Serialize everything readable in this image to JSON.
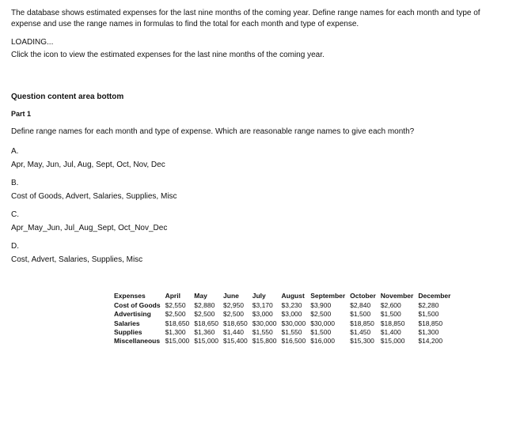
{
  "intro": "The database shows estimated expenses for the last nine months of the coming year. Define range names for each month and type of expense and use the range names in formulas to find the total for each month and type of expense.",
  "loading": "LOADING...",
  "loading_sub": "Click the icon to view the estimated expenses for the last nine months of the coming year.",
  "section_title": "Question content area bottom",
  "part_label": "Part 1",
  "prompt": "Define range names for each month and type of expense. Which are reasonable range names to give each month?",
  "options": {
    "a": {
      "letter": "A.",
      "text": "Apr, May, Jun, Jul, Aug, Sept, Oct, Nov, Dec"
    },
    "b": {
      "letter": "B.",
      "text": "Cost of Goods, Advert, Salaries, Supplies, Misc"
    },
    "c": {
      "letter": "C.",
      "text": "Apr_May_Jun, Jul_Aug_Sept, Oct_Nov_Dec"
    },
    "d": {
      "letter": "D.",
      "text": "Cost, Advert, Salaries, Supplies, Misc"
    }
  },
  "table": {
    "headers": [
      "Expenses",
      "April",
      "May",
      "June",
      "July",
      "August",
      "September",
      "October",
      "November",
      "December"
    ],
    "rows": [
      [
        "Cost of Goods",
        "$2,550",
        "$2,880",
        "$2,950",
        "$3,170",
        "$3,230",
        "$3,900",
        "$2,840",
        "$2,600",
        "$2,280"
      ],
      [
        "Advertising",
        "$2,500",
        "$2,500",
        "$2,500",
        "$3,000",
        "$3,000",
        "$2,500",
        "$1,500",
        "$1,500",
        "$1,500"
      ],
      [
        "Salaries",
        "$18,650",
        "$18,650",
        "$18,650",
        "$30,000",
        "$30,000",
        "$30,000",
        "$18,850",
        "$18,850",
        "$18,850"
      ],
      [
        "Supplies",
        "$1,300",
        "$1,360",
        "$1,440",
        "$1,550",
        "$1,550",
        "$1,500",
        "$1,450",
        "$1,400",
        "$1,300"
      ],
      [
        "Miscellaneous",
        "$15,000",
        "$15,000",
        "$15,400",
        "$15,800",
        "$16,500",
        "$16,000",
        "$15,300",
        "$15,000",
        "$14,200"
      ]
    ]
  },
  "chart_data": {
    "type": "table",
    "title": "Estimated expenses for the last nine months",
    "columns": [
      "April",
      "May",
      "June",
      "July",
      "August",
      "September",
      "October",
      "November",
      "December"
    ],
    "series": [
      {
        "name": "Cost of Goods",
        "values": [
          2550,
          2880,
          2950,
          3170,
          3230,
          3900,
          2840,
          2600,
          2280
        ]
      },
      {
        "name": "Advertising",
        "values": [
          2500,
          2500,
          2500,
          3000,
          3000,
          2500,
          1500,
          1500,
          1500
        ]
      },
      {
        "name": "Salaries",
        "values": [
          18650,
          18650,
          18650,
          30000,
          30000,
          30000,
          18850,
          18850,
          18850
        ]
      },
      {
        "name": "Supplies",
        "values": [
          1300,
          1360,
          1440,
          1550,
          1550,
          1500,
          1450,
          1400,
          1300
        ]
      },
      {
        "name": "Miscellaneous",
        "values": [
          15000,
          15000,
          15400,
          15800,
          16500,
          16000,
          15300,
          15000,
          14200
        ]
      }
    ]
  }
}
